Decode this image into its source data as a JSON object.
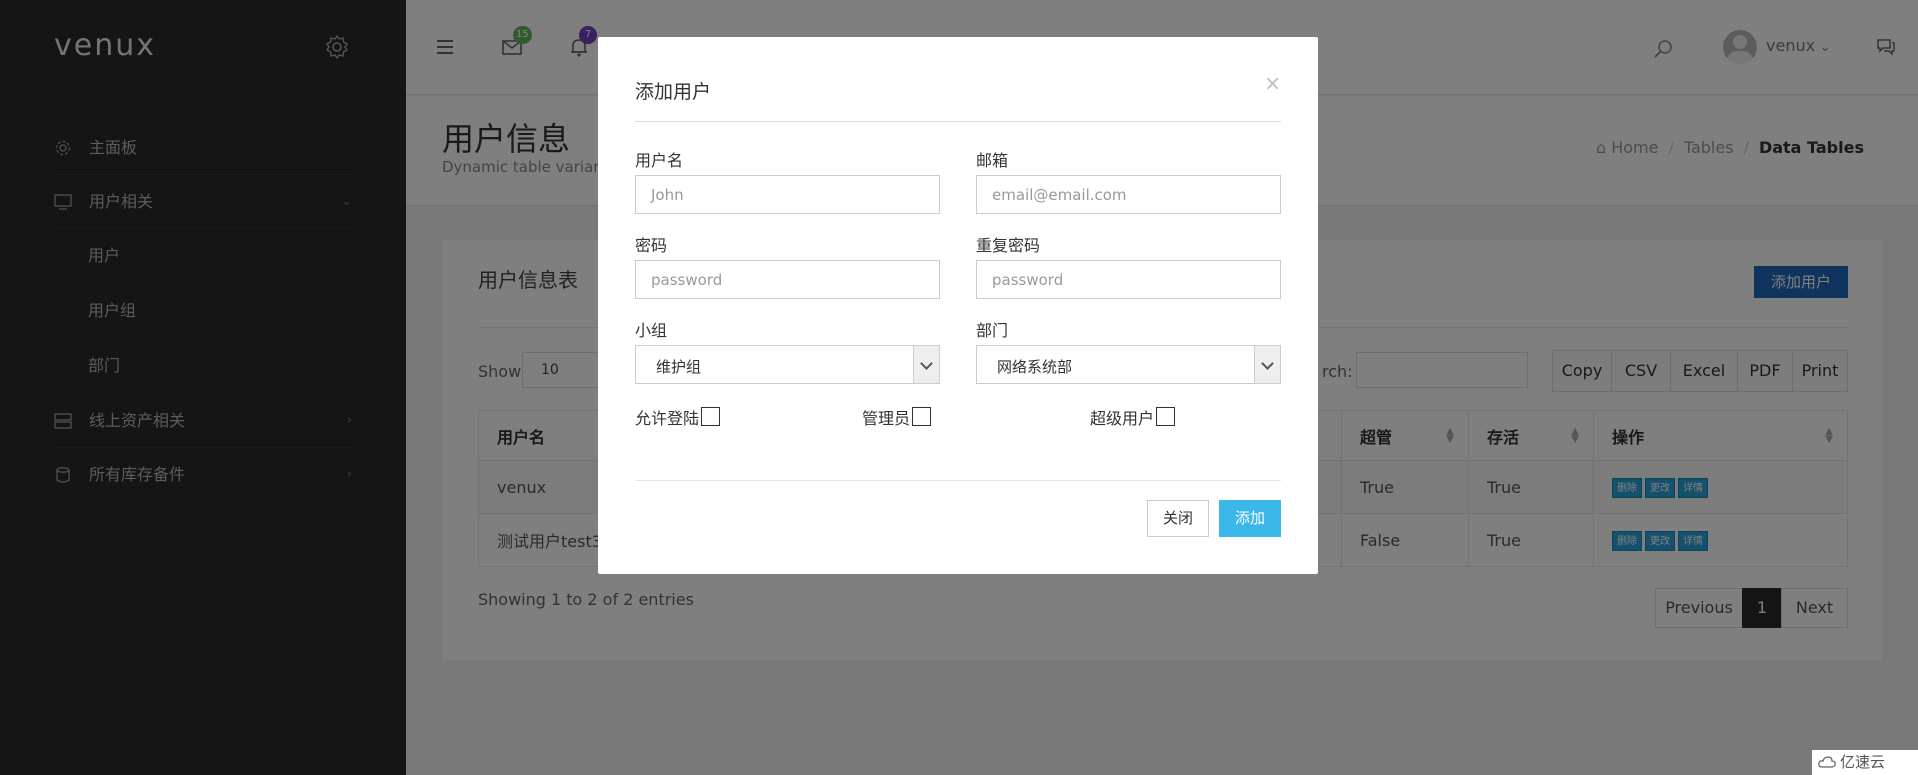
{
  "app": {
    "logo": "venux"
  },
  "sidebar": {
    "items": [
      {
        "label": "主面板",
        "icon": "gear-icon"
      },
      {
        "label": "用户相关",
        "icon": "monitor-icon",
        "expanded": true
      },
      {
        "label": "用户",
        "sub": true
      },
      {
        "label": "用户组",
        "sub": true
      },
      {
        "label": "部门",
        "sub": true
      },
      {
        "label": "线上资产相关",
        "icon": "server-icon"
      },
      {
        "label": "所有库存备件",
        "icon": "database-icon"
      }
    ]
  },
  "topbar": {
    "mail_badge": "15",
    "bell_badge": "7",
    "user": "venux",
    "badge_colors": {
      "mail": "#5cb85c",
      "bell": "#6f42c1"
    }
  },
  "page": {
    "title": "用户信息",
    "subtitle": "Dynamic table variants",
    "breadcrumb": {
      "home": "Home",
      "tables": "Tables",
      "current": "Data Tables"
    }
  },
  "panel": {
    "title": "用户信息表",
    "add_button": "添加用户",
    "show_label": "Show",
    "page_length": "10",
    "search_label": "rch:",
    "export_buttons": [
      "Copy",
      "CSV",
      "Excel",
      "PDF",
      "Print"
    ],
    "columns": [
      "用户名",
      "超管",
      "存活",
      "操作"
    ],
    "rows": [
      {
        "username": "venux",
        "superuser": "True",
        "alive": "True"
      },
      {
        "username": "测试用户test3",
        "superuser": "False",
        "alive": "True"
      }
    ],
    "actions": [
      "删除",
      "更改",
      "详情"
    ],
    "info": "Showing 1 to 2 of 2 entries",
    "pagination": {
      "previous": "Previous",
      "page": "1",
      "next": "Next"
    }
  },
  "modal": {
    "title": "添加用户",
    "close_symbol": "×",
    "username": {
      "label": "用户名",
      "placeholder": "John"
    },
    "email": {
      "label": "邮箱",
      "placeholder": "email@email.com"
    },
    "password": {
      "label": "密码",
      "placeholder": "password"
    },
    "password2": {
      "label": "重复密码",
      "placeholder": "password"
    },
    "group": {
      "label": "小组",
      "value": "维护组"
    },
    "dept": {
      "label": "部门",
      "value": "网络系统部"
    },
    "checks": {
      "login": "允许登陆",
      "admin": "管理员",
      "super": "超级用户"
    },
    "close_button": "关闭",
    "submit_button": "添加"
  },
  "watermark": "亿速云"
}
